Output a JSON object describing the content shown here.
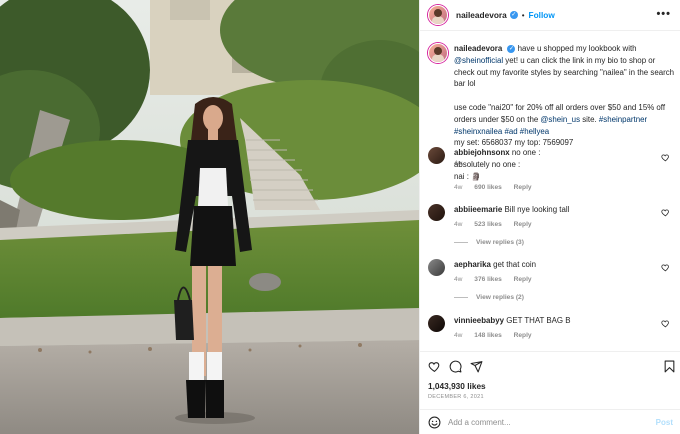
{
  "post": {
    "username": "naileadevora",
    "follow_label": "Follow",
    "separator": "•",
    "more_label": "•••"
  },
  "caption": {
    "username": "naileadevora",
    "text_1": "have u shopped my lookbook with ",
    "mention_1": "@sheinofficial",
    "text_2": " yet! u can click the link in my bio to shop or check out my favorite styles by searching \"nailea\" in the search bar lol",
    "text_3": "use code \"nai20\" for 20% off all orders over $50 and 15% off orders under $50 on the ",
    "mention_2": "@shein_us",
    "text_4": " site. ",
    "hashtags": "#sheinpartner #sheinxnailea #ad #hellyea",
    "text_5": "my set: 6568037 my top: 7569097",
    "time": "4w"
  },
  "comments": [
    {
      "username": "abbiejohnsonx",
      "lines": [
        "no one :",
        "absolutely no one :",
        "nai : 🗿"
      ],
      "time": "4w",
      "likes": "690 likes",
      "reply": "Reply"
    },
    {
      "username": "abbiieemarie",
      "lines": [
        "Bill nye looking tall"
      ],
      "time": "4w",
      "likes": "523 likes",
      "reply": "Reply",
      "view_replies": "View replies (3)"
    },
    {
      "username": "aepharika",
      "lines": [
        "get that coin"
      ],
      "time": "4w",
      "likes": "376 likes",
      "reply": "Reply",
      "view_replies": "View replies (2)"
    },
    {
      "username": "vinnieebabyy",
      "lines": [
        "GET THAT BAG B"
      ],
      "time": "4w",
      "likes": "148 likes",
      "reply": "Reply"
    }
  ],
  "stats": {
    "likes": "1,043,930 likes",
    "date": "DECEMBER 6, 2021"
  },
  "composer": {
    "placeholder": "Add a comment...",
    "post_label": "Post"
  },
  "icons": [
    "heart-icon",
    "comment-icon",
    "share-icon",
    "bookmark-icon",
    "emoji-icon",
    "verified-badge-icon",
    "more-icon"
  ],
  "colors": {
    "link": "#00376b",
    "follow": "#0095f6",
    "verified": "#3897f0",
    "muted": "#8e8e8e",
    "post_disabled": "#b2dffc"
  }
}
